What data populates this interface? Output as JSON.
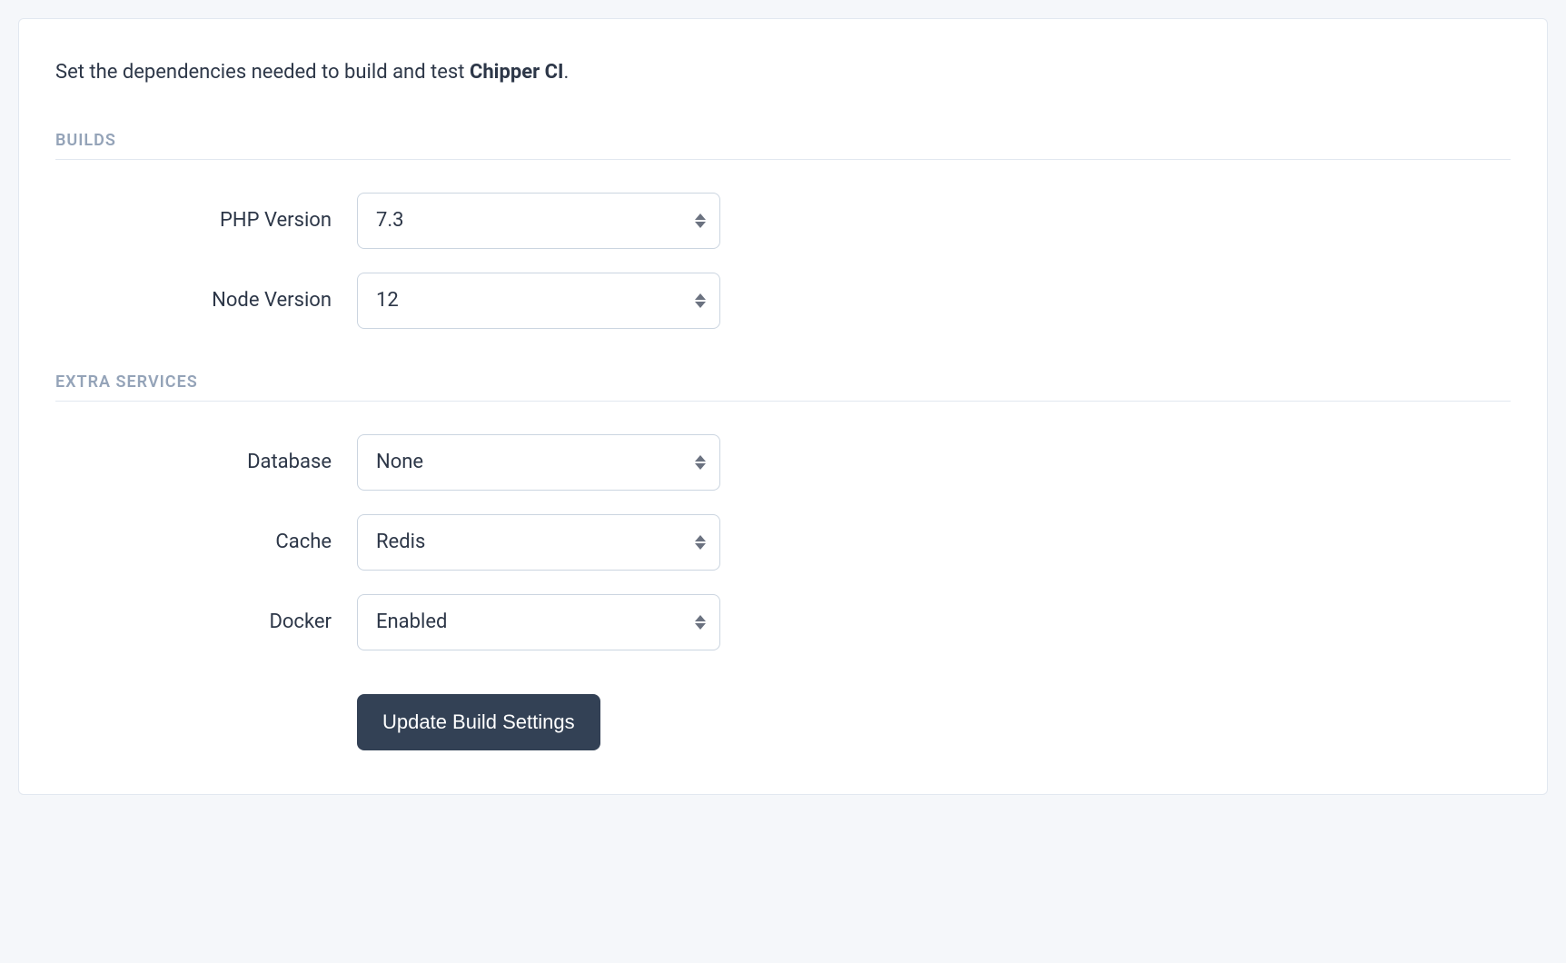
{
  "intro": {
    "prefix": "Set the dependencies needed to build and test ",
    "project_name": "Chipper CI",
    "suffix": "."
  },
  "sections": {
    "builds": {
      "title": "BUILDS",
      "fields": {
        "php_version": {
          "label": "PHP Version",
          "value": "7.3"
        },
        "node_version": {
          "label": "Node Version",
          "value": "12"
        }
      }
    },
    "extra_services": {
      "title": "EXTRA SERVICES",
      "fields": {
        "database": {
          "label": "Database",
          "value": "None"
        },
        "cache": {
          "label": "Cache",
          "value": "Redis"
        },
        "docker": {
          "label": "Docker",
          "value": "Enabled"
        }
      }
    }
  },
  "actions": {
    "submit_label": "Update Build Settings"
  }
}
